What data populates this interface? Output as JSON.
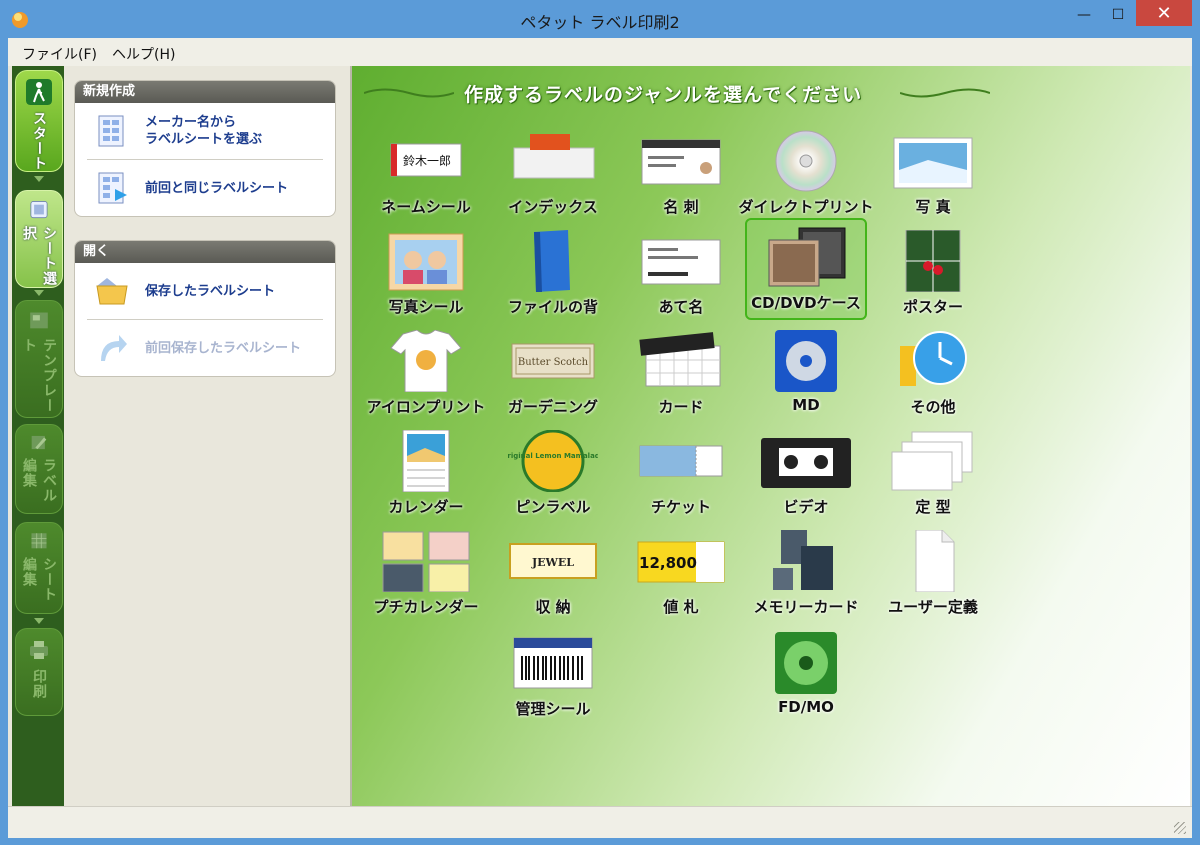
{
  "window": {
    "title": "ペタット ラベル印刷2"
  },
  "menu": [
    {
      "label": "ファイル(F)"
    },
    {
      "label": "ヘルプ(H)"
    }
  ],
  "nav": {
    "start": "スタート",
    "sheet_select": "シート選択",
    "template": "テンプレート",
    "label_edit": "ラベル編集",
    "sheet_edit": "シート編集",
    "print": "印刷"
  },
  "panel": {
    "new": {
      "heading": "新規作成",
      "maker": "メーカー名から\nラベルシートを選ぶ",
      "same": "前回と同じラベルシート"
    },
    "open": {
      "heading": "開く",
      "saved": "保存したラベルシート",
      "last_saved": "前回保存したラベルシート"
    }
  },
  "main": {
    "title": "作成するラベルのジャンルを選んでください",
    "genres": [
      {
        "label": "ネームシール",
        "sample": "鈴木一郎"
      },
      {
        "label": "インデックス"
      },
      {
        "label": "名 刺"
      },
      {
        "label": "ダイレクトプリント"
      },
      {
        "label": "写 真"
      },
      {
        "label": "写真シール"
      },
      {
        "label": "ファイルの背"
      },
      {
        "label": "あて名"
      },
      {
        "label": "CD/DVDケース"
      },
      {
        "label": "ポスター"
      },
      {
        "label": "アイロンプリント"
      },
      {
        "label": "ガーデニング",
        "sample": "Butter Scotch"
      },
      {
        "label": "カード"
      },
      {
        "label": "MD"
      },
      {
        "label": "その他"
      },
      {
        "label": "カレンダー"
      },
      {
        "label": "ピンラベル",
        "sample": "Original Lemon Mamalade"
      },
      {
        "label": "チケット"
      },
      {
        "label": "ビデオ"
      },
      {
        "label": "定 型"
      },
      {
        "label": "プチカレンダー"
      },
      {
        "label": "収 納",
        "sample": "JEWEL"
      },
      {
        "label": "値 札",
        "sample": "12,800"
      },
      {
        "label": "メモリーカード"
      },
      {
        "label": "ユーザー定義"
      },
      {
        "label": "管理シール"
      },
      {
        "label": "FD/MO"
      }
    ]
  },
  "colors": {
    "accent": "#59a71e",
    "titlebar": "#5b9bd8",
    "link": "#1d3d8e",
    "close": "#c9483f"
  }
}
